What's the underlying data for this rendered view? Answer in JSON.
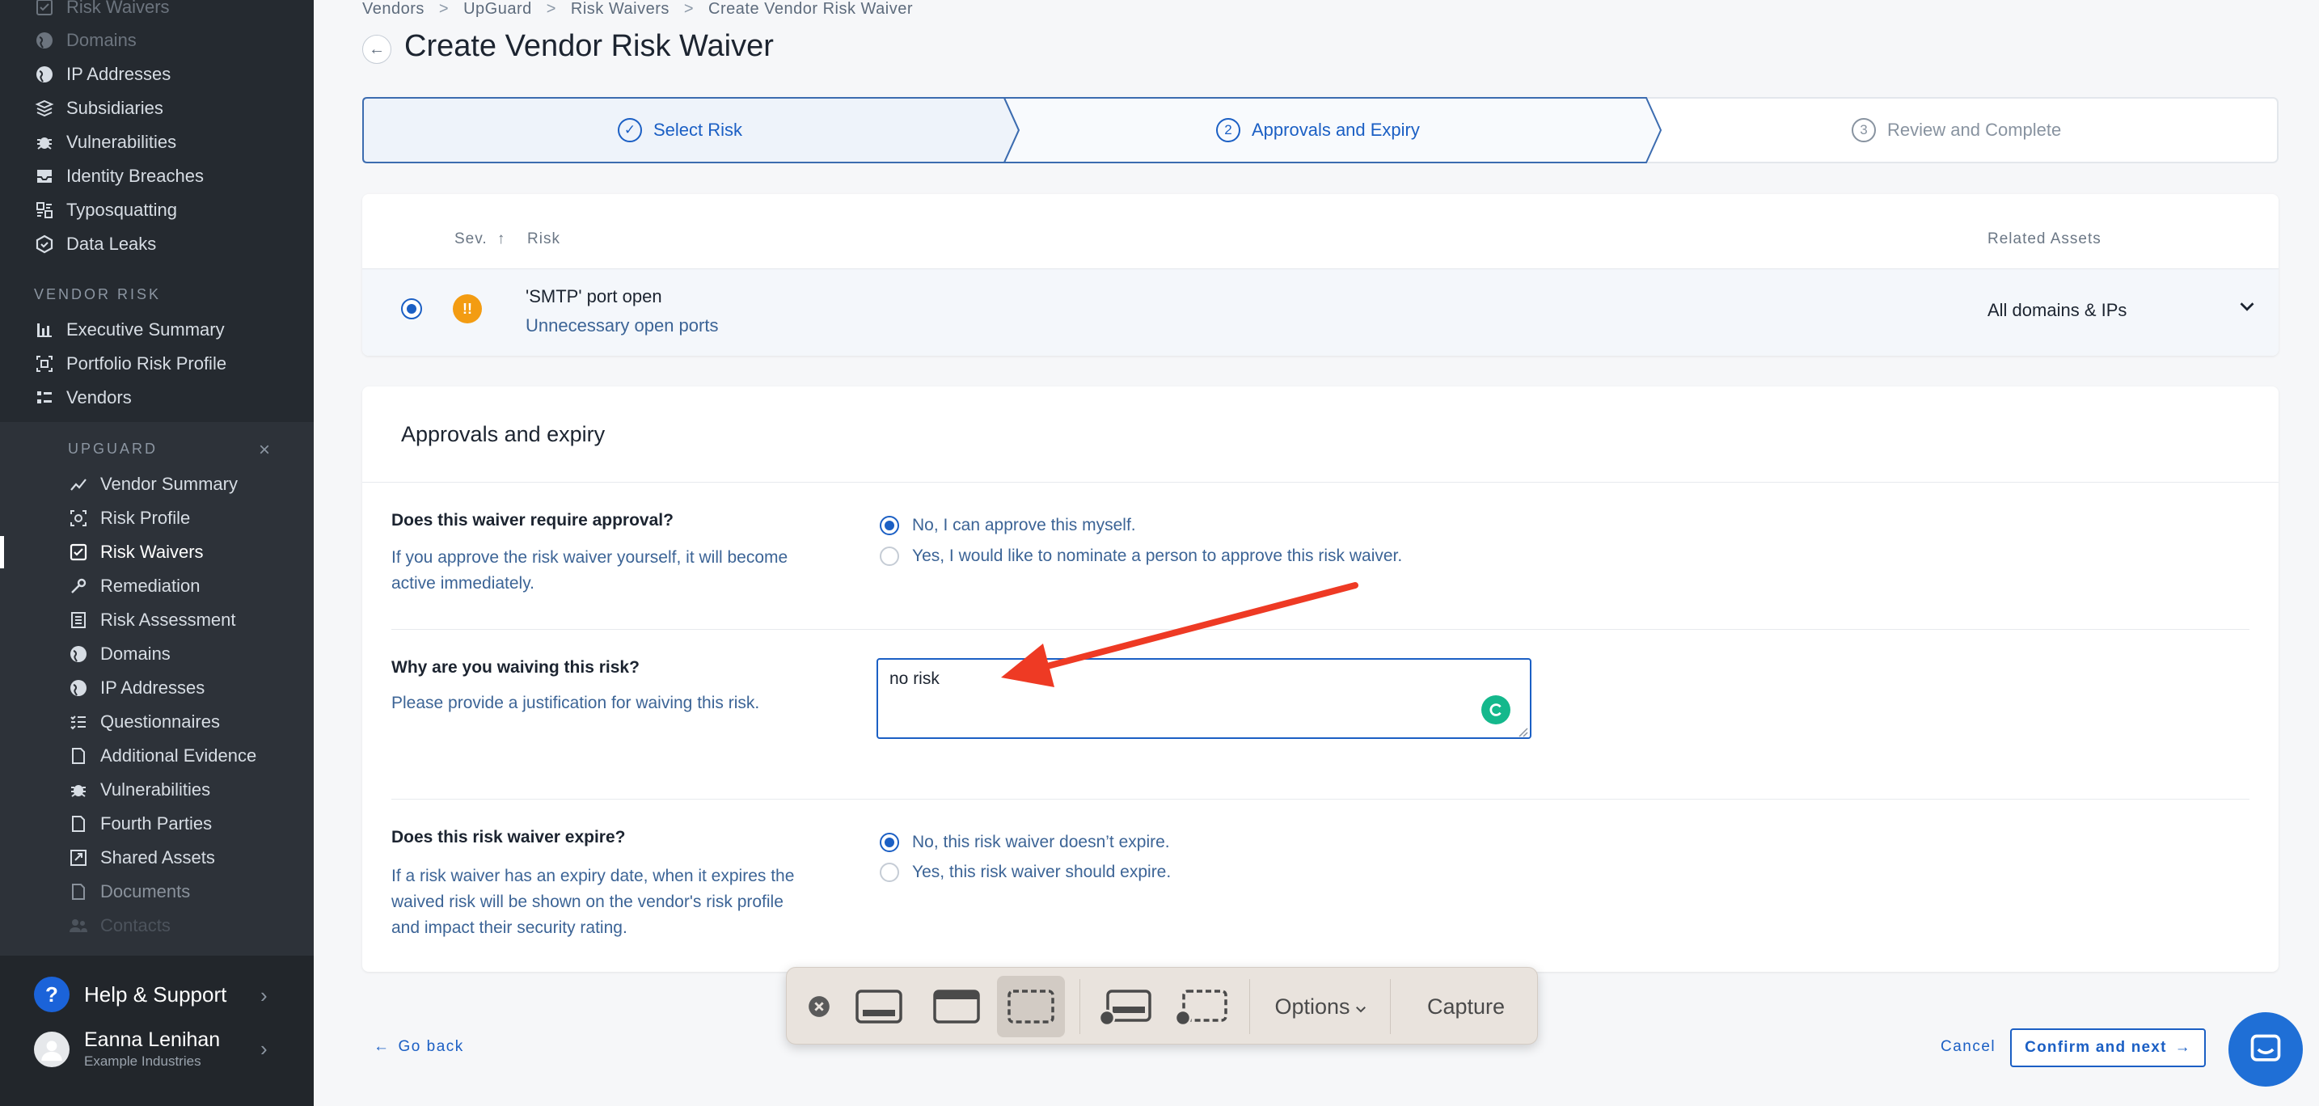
{
  "sidebar": {
    "top_items": [
      {
        "label": "Risk Waivers",
        "icon": "check-square-icon"
      },
      {
        "label": "Domains",
        "icon": "globe-icon"
      },
      {
        "label": "IP Addresses",
        "icon": "globe-pin-icon"
      },
      {
        "label": "Subsidiaries",
        "icon": "layers-icon"
      },
      {
        "label": "Vulnerabilities",
        "icon": "bug-icon"
      },
      {
        "label": "Identity Breaches",
        "icon": "inbox-icon"
      },
      {
        "label": "Typosquatting",
        "icon": "typosquat-icon"
      },
      {
        "label": "Data Leaks",
        "icon": "hexagon-icon"
      }
    ],
    "vendor_risk_label": "VENDOR RISK",
    "vendor_risk_items": [
      {
        "label": "Executive Summary",
        "icon": "bar-chart-icon"
      },
      {
        "label": "Portfolio Risk Profile",
        "icon": "portfolio-icon"
      },
      {
        "label": "Vendors",
        "icon": "list-icon"
      }
    ],
    "upguard_label": "UPGUARD",
    "upguard_close": "×",
    "upguard_items": [
      {
        "label": "Vendor Summary",
        "icon": "trend-line-icon"
      },
      {
        "label": "Risk Profile",
        "icon": "risk-profile-icon"
      },
      {
        "label": "Risk Waivers",
        "icon": "check-square-icon"
      },
      {
        "label": "Remediation",
        "icon": "wrench-icon"
      },
      {
        "label": "Risk Assessment",
        "icon": "document-list-icon"
      },
      {
        "label": "Domains",
        "icon": "globe-icon"
      },
      {
        "label": "IP Addresses",
        "icon": "globe-pin-icon"
      },
      {
        "label": "Questionnaires",
        "icon": "checklist-icon"
      },
      {
        "label": "Additional Evidence",
        "icon": "file-icon"
      },
      {
        "label": "Vulnerabilities",
        "icon": "bug-icon"
      },
      {
        "label": "Fourth Parties",
        "icon": "file-icon"
      },
      {
        "label": "Shared Assets",
        "icon": "share-icon"
      },
      {
        "label": "Documents",
        "icon": "file-icon"
      },
      {
        "label": "Contacts",
        "icon": "people-icon"
      }
    ],
    "help_label": "Help & Support",
    "help_icon_char": "?",
    "user_name": "Eanna Lenihan",
    "user_org": "Example Industries"
  },
  "breadcrumb": [
    "Vendors",
    "UpGuard",
    "Risk Waivers",
    "Create Vendor Risk Waiver"
  ],
  "breadcrumb_sep": ">",
  "page_title": "Create Vendor Risk Waiver",
  "stepper": {
    "steps": [
      {
        "number": "✓",
        "label": "Select Risk",
        "state": "complete"
      },
      {
        "number": "2",
        "label": "Approvals and Expiry",
        "state": "current"
      },
      {
        "number": "3",
        "label": "Review and Complete",
        "state": "upcoming"
      }
    ]
  },
  "risk_table": {
    "headers": {
      "sev": "Sev.",
      "sort_arrow": "↑",
      "risk": "Risk",
      "assets": "Related Assets"
    },
    "row": {
      "severity_symbol": "!!",
      "title": "'SMTP' port open",
      "subtitle": "Unnecessary open ports",
      "assets": "All domains & IPs",
      "selected": true
    }
  },
  "approvals": {
    "card_title": "Approvals and expiry",
    "approval": {
      "question": "Does this waiver require approval?",
      "description": "If you approve the risk waiver yourself, it will become active immediately.",
      "options": [
        "No, I can approve this myself.",
        "Yes, I would like to nominate a person to approve this risk waiver."
      ],
      "selected_index": 0
    },
    "justification": {
      "question": "Why are you waiving this risk?",
      "description": "Please provide a justification for waiving this risk.",
      "value": "no risk"
    },
    "expiry": {
      "question": "Does this risk waiver expire?",
      "description": "If a risk waiver has an expiry date, when it expires the waived risk will be shown on the vendor's risk profile and impact their security rating.",
      "options": [
        "No, this risk waiver doesn’t expire.",
        "Yes, this risk waiver should expire."
      ],
      "selected_index": 0
    }
  },
  "actions": {
    "go_back": "Go back",
    "cancel": "Cancel",
    "confirm": "Confirm and next"
  },
  "capture_toolbar": {
    "options_label": "Options",
    "capture_label": "Capture"
  },
  "colors": {
    "accent": "#1b5fc4",
    "sidebar_bg": "#252a30",
    "severity_medium": "#f39c12",
    "annotation_arrow": "#ee3a24"
  }
}
